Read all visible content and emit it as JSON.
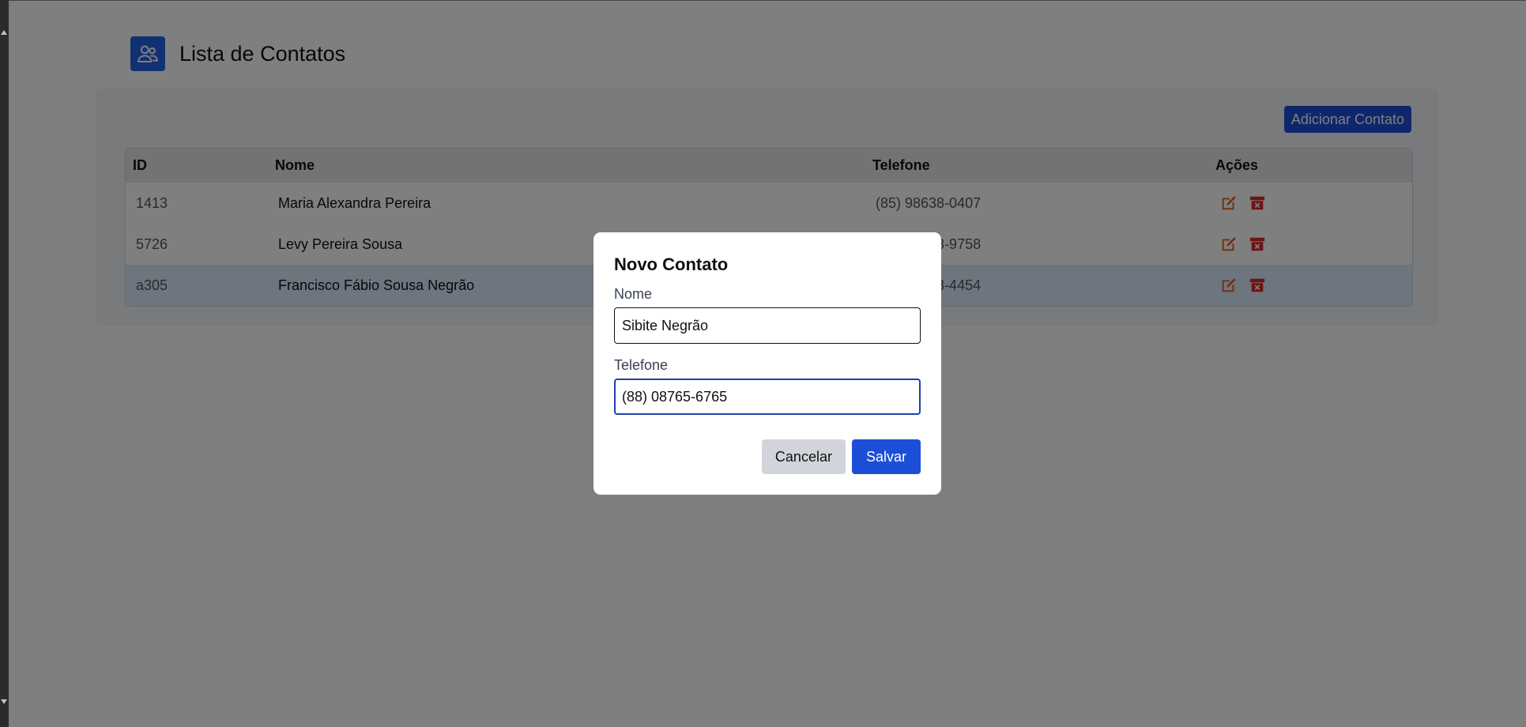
{
  "header": {
    "title": "Lista de Contatos",
    "logo_icon": "users-icon"
  },
  "toolbar": {
    "add_label": "Adicionar Contato"
  },
  "table": {
    "columns": [
      "ID",
      "Nome",
      "Telefone",
      "Ações"
    ],
    "rows": [
      {
        "id": "1413",
        "nome": "Maria Alexandra Pereira",
        "telefone": "(85) 98638-0407"
      },
      {
        "id": "5726",
        "nome": "Levy Pereira Sousa",
        "telefone": "(85) 98638-9758"
      },
      {
        "id": "a305",
        "nome": "Francisco Fábio Sousa Negrão",
        "telefone": "(85) 98638-4454"
      }
    ],
    "highlighted_row": 2,
    "action_icons": [
      "edit-icon",
      "delete-icon"
    ]
  },
  "modal": {
    "title": "Novo Contato",
    "nome_label": "Nome",
    "nome_value": "Sibite Negrão",
    "telefone_label": "Telefone",
    "telefone_value": "(88) 08765-6765",
    "cancel_label": "Cancelar",
    "save_label": "Salvar"
  },
  "colors": {
    "accent": "#1d4ed8",
    "edit_icon": "#ea580c",
    "delete_icon": "#dc2626",
    "overlay": "rgba(0,0,0,0.5)"
  }
}
